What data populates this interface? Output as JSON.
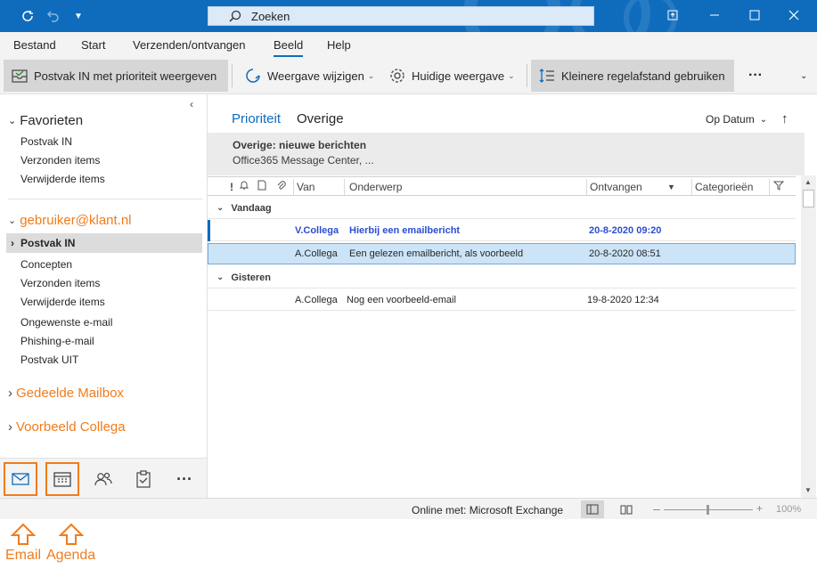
{
  "title_bar": {
    "search_placeholder": "Zoeken",
    "icons": [
      "refresh-icon",
      "undo-icon",
      "customize-icon",
      "search-icon",
      "restore-window-icon",
      "minimize-icon",
      "maximize-icon",
      "close-icon"
    ]
  },
  "menu": {
    "items": [
      "Bestand",
      "Start",
      "Verzenden/ontvangen",
      "Beeld",
      "Help"
    ],
    "active": "Beeld"
  },
  "ribbon": {
    "priority_inbox": "Postvak IN met prioriteit weergeven",
    "change_view": "Weergave wijzigen",
    "current_view": "Huidige weergave",
    "smaller_spacing": "Kleinere regelafstand gebruiken",
    "more": "···"
  },
  "folders": {
    "favorites_header": "Favorieten",
    "favorites": [
      "Postvak IN",
      "Verzonden items",
      "Verwijderde items"
    ],
    "account": "gebruiker@klant.nl",
    "selected_folder": "Postvak IN",
    "account_folders": [
      "Concepten",
      "Verzonden items",
      "Verwijderde items",
      "Ongewenste e-mail",
      "Phishing-e-mail",
      "Postvak UIT"
    ],
    "shared_mailbox": "Gedeelde Mailbox",
    "colleague": "Voorbeeld Collega"
  },
  "message_list": {
    "tabs": [
      "Prioriteit",
      "Overige"
    ],
    "active_tab": "Prioriteit",
    "sort_label": "Op Datum",
    "other_banner_title": "Overige: nieuwe berichten",
    "other_banner_sub": "Office365 Message Center, ...",
    "columns": {
      "flag": "!",
      "from": "Van",
      "subject": "Onderwerp",
      "received": "Ontvangen",
      "categories": "Categorieën"
    },
    "groups": [
      {
        "label": "Vandaag",
        "messages": [
          {
            "from": "V.Collega",
            "subject": "Hierbij een emailbericht",
            "received": "20-8-2020 09:20",
            "state": "unread"
          },
          {
            "from": "A.Collega",
            "subject": "Een gelezen emailbericht, als voorbeeld",
            "received": "20-8-2020 08:51",
            "state": "selected"
          }
        ]
      },
      {
        "label": "Gisteren",
        "messages": [
          {
            "from": "A.Collega",
            "subject": "Nog een voorbeeld-email",
            "received": "19-8-2020 12:34",
            "state": "read"
          }
        ]
      }
    ]
  },
  "status_bar": {
    "connection": "Online met: Microsoft Exchange",
    "zoom": "100%"
  },
  "annotations": {
    "email": "Email",
    "agenda": "Agenda"
  },
  "colors": {
    "accent": "#0f6cbd",
    "orange": "#f07c1c",
    "unread": "#2b4ed1"
  }
}
